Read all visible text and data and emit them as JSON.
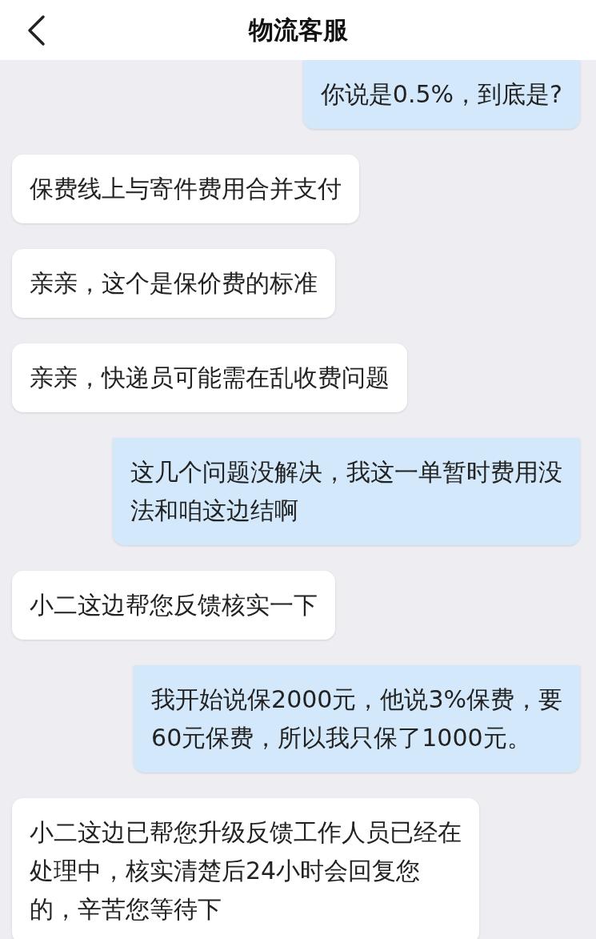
{
  "header": {
    "title": "物流客服"
  },
  "messages": [
    {
      "kind": "sent",
      "lines": [
        "你说是0.5%，到底是?"
      ]
    },
    {
      "kind": "received",
      "lines": [
        "保费线上与寄件费用合并支付"
      ]
    },
    {
      "kind": "received",
      "lines": [
        "亲亲，这个是保价费的标准"
      ]
    },
    {
      "kind": "received",
      "lines": [
        "亲亲，快递员可能需在乱收费问题"
      ]
    },
    {
      "kind": "sent",
      "lines": [
        "这几个问题没解决，我这一单暂时费用没",
        "法和咱这边结啊"
      ]
    },
    {
      "kind": "received",
      "lines": [
        "小二这边帮您反馈核实一下"
      ]
    },
    {
      "kind": "sent",
      "lines": [
        "我开始说保2000元，他说3%保费，要",
        "60元保费，所以我只保了1000元。"
      ]
    },
    {
      "kind": "received",
      "lines": [
        "小二这边已帮您升级反馈工作人员已经在",
        "处理中，核实清楚后24小时会回复您",
        "的，辛苦您等待下"
      ]
    }
  ]
}
